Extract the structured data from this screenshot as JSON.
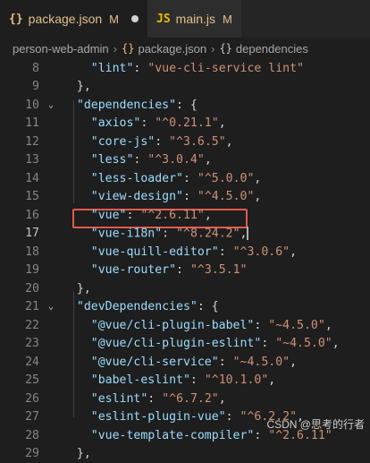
{
  "tabs": [
    {
      "icon": "{}",
      "label": "package.json",
      "status": "M",
      "active": true
    },
    {
      "icon": "JS",
      "label": "main.js",
      "status": "M",
      "active": false
    }
  ],
  "breadcrumb": {
    "folder": "person-web-admin",
    "file_icon": "{}",
    "file": "package.json",
    "symbol_icon": "{}",
    "symbol": "dependencies"
  },
  "lines": [
    {
      "num": "8",
      "tokens": [
        [
          "p",
          "    "
        ],
        [
          "k",
          "\"lint\""
        ],
        [
          "p",
          ": "
        ],
        [
          "s",
          "\"vue-cli-service lint\""
        ]
      ]
    },
    {
      "num": "9",
      "tokens": [
        [
          "p",
          "  },"
        ]
      ]
    },
    {
      "num": "10",
      "fold": true,
      "tokens": [
        [
          "p",
          "  "
        ],
        [
          "k",
          "\"dependencies\""
        ],
        [
          "p",
          ": {"
        ]
      ]
    },
    {
      "num": "11",
      "tokens": [
        [
          "p",
          "    "
        ],
        [
          "k",
          "\"axios\""
        ],
        [
          "p",
          ": "
        ],
        [
          "s",
          "\"^0.21.1\""
        ],
        [
          "p",
          ","
        ]
      ]
    },
    {
      "num": "12",
      "tokens": [
        [
          "p",
          "    "
        ],
        [
          "k",
          "\"core-js\""
        ],
        [
          "p",
          ": "
        ],
        [
          "s",
          "\"^3.6.5\""
        ],
        [
          "p",
          ","
        ]
      ]
    },
    {
      "num": "13",
      "tokens": [
        [
          "p",
          "    "
        ],
        [
          "k",
          "\"less\""
        ],
        [
          "p",
          ": "
        ],
        [
          "s",
          "\"^3.0.4\""
        ],
        [
          "p",
          ","
        ]
      ]
    },
    {
      "num": "14",
      "tokens": [
        [
          "p",
          "    "
        ],
        [
          "k",
          "\"less-loader\""
        ],
        [
          "p",
          ": "
        ],
        [
          "s",
          "\"^5.0.0\""
        ],
        [
          "p",
          ","
        ]
      ]
    },
    {
      "num": "15",
      "tokens": [
        [
          "p",
          "    "
        ],
        [
          "k",
          "\"view-design\""
        ],
        [
          "p",
          ": "
        ],
        [
          "s",
          "\"^4.5.0\""
        ],
        [
          "p",
          ","
        ]
      ]
    },
    {
      "num": "16",
      "tokens": [
        [
          "p",
          "    "
        ],
        [
          "k",
          "\"vue\""
        ],
        [
          "p",
          ": "
        ],
        [
          "s",
          "\"^2.6.11\""
        ],
        [
          "p",
          ","
        ]
      ]
    },
    {
      "num": "17",
      "current": true,
      "tokens": [
        [
          "p",
          "    "
        ],
        [
          "k",
          "\"vue-i18n\""
        ],
        [
          "p",
          ": "
        ],
        [
          "s",
          "\"^8.24.2\""
        ],
        [
          "p",
          ","
        ]
      ]
    },
    {
      "num": "18",
      "tokens": [
        [
          "p",
          "    "
        ],
        [
          "k",
          "\"vue-quill-editor\""
        ],
        [
          "p",
          ": "
        ],
        [
          "s",
          "\"^3.0.6\""
        ],
        [
          "p",
          ","
        ]
      ]
    },
    {
      "num": "19",
      "tokens": [
        [
          "p",
          "    "
        ],
        [
          "k",
          "\"vue-router\""
        ],
        [
          "p",
          ": "
        ],
        [
          "s",
          "\"^3.5.1\""
        ]
      ]
    },
    {
      "num": "20",
      "tokens": [
        [
          "p",
          "  },"
        ]
      ]
    },
    {
      "num": "21",
      "fold": true,
      "tokens": [
        [
          "p",
          "  "
        ],
        [
          "k",
          "\"devDependencies\""
        ],
        [
          "p",
          ": {"
        ]
      ]
    },
    {
      "num": "22",
      "tokens": [
        [
          "p",
          "    "
        ],
        [
          "k",
          "\"@vue/cli-plugin-babel\""
        ],
        [
          "p",
          ": "
        ],
        [
          "s",
          "\"~4.5.0\""
        ],
        [
          "p",
          ","
        ]
      ]
    },
    {
      "num": "23",
      "tokens": [
        [
          "p",
          "    "
        ],
        [
          "k",
          "\"@vue/cli-plugin-eslint\""
        ],
        [
          "p",
          ": "
        ],
        [
          "s",
          "\"~4.5.0\""
        ],
        [
          "p",
          ","
        ]
      ]
    },
    {
      "num": "24",
      "tokens": [
        [
          "p",
          "    "
        ],
        [
          "k",
          "\"@vue/cli-service\""
        ],
        [
          "p",
          ": "
        ],
        [
          "s",
          "\"~4.5.0\""
        ],
        [
          "p",
          ","
        ]
      ]
    },
    {
      "num": "25",
      "tokens": [
        [
          "p",
          "    "
        ],
        [
          "k",
          "\"babel-eslint\""
        ],
        [
          "p",
          ": "
        ],
        [
          "s",
          "\"^10.1.0\""
        ],
        [
          "p",
          ","
        ]
      ]
    },
    {
      "num": "26",
      "tokens": [
        [
          "p",
          "    "
        ],
        [
          "k",
          "\"eslint\""
        ],
        [
          "p",
          ": "
        ],
        [
          "s",
          "\"^6.7.2\""
        ],
        [
          "p",
          ","
        ]
      ]
    },
    {
      "num": "27",
      "tokens": [
        [
          "p",
          "    "
        ],
        [
          "k",
          "\"eslint-plugin-vue\""
        ],
        [
          "p",
          ": "
        ],
        [
          "s",
          "\"^6.2.2\""
        ],
        [
          "p",
          ","
        ]
      ]
    },
    {
      "num": "28",
      "tokens": [
        [
          "p",
          "    "
        ],
        [
          "k",
          "\"vue-template-compiler\""
        ],
        [
          "p",
          ": "
        ],
        [
          "s",
          "\"^2.6.11\""
        ]
      ]
    },
    {
      "num": "29",
      "tokens": [
        [
          "p",
          "  },"
        ]
      ]
    }
  ],
  "watermark": "CSDN @思考的行者",
  "colors": {
    "highlight_border": "#e05a4f",
    "key": "#9cdcfe",
    "string": "#ce9178",
    "tab_modified": "#e2c08d"
  }
}
